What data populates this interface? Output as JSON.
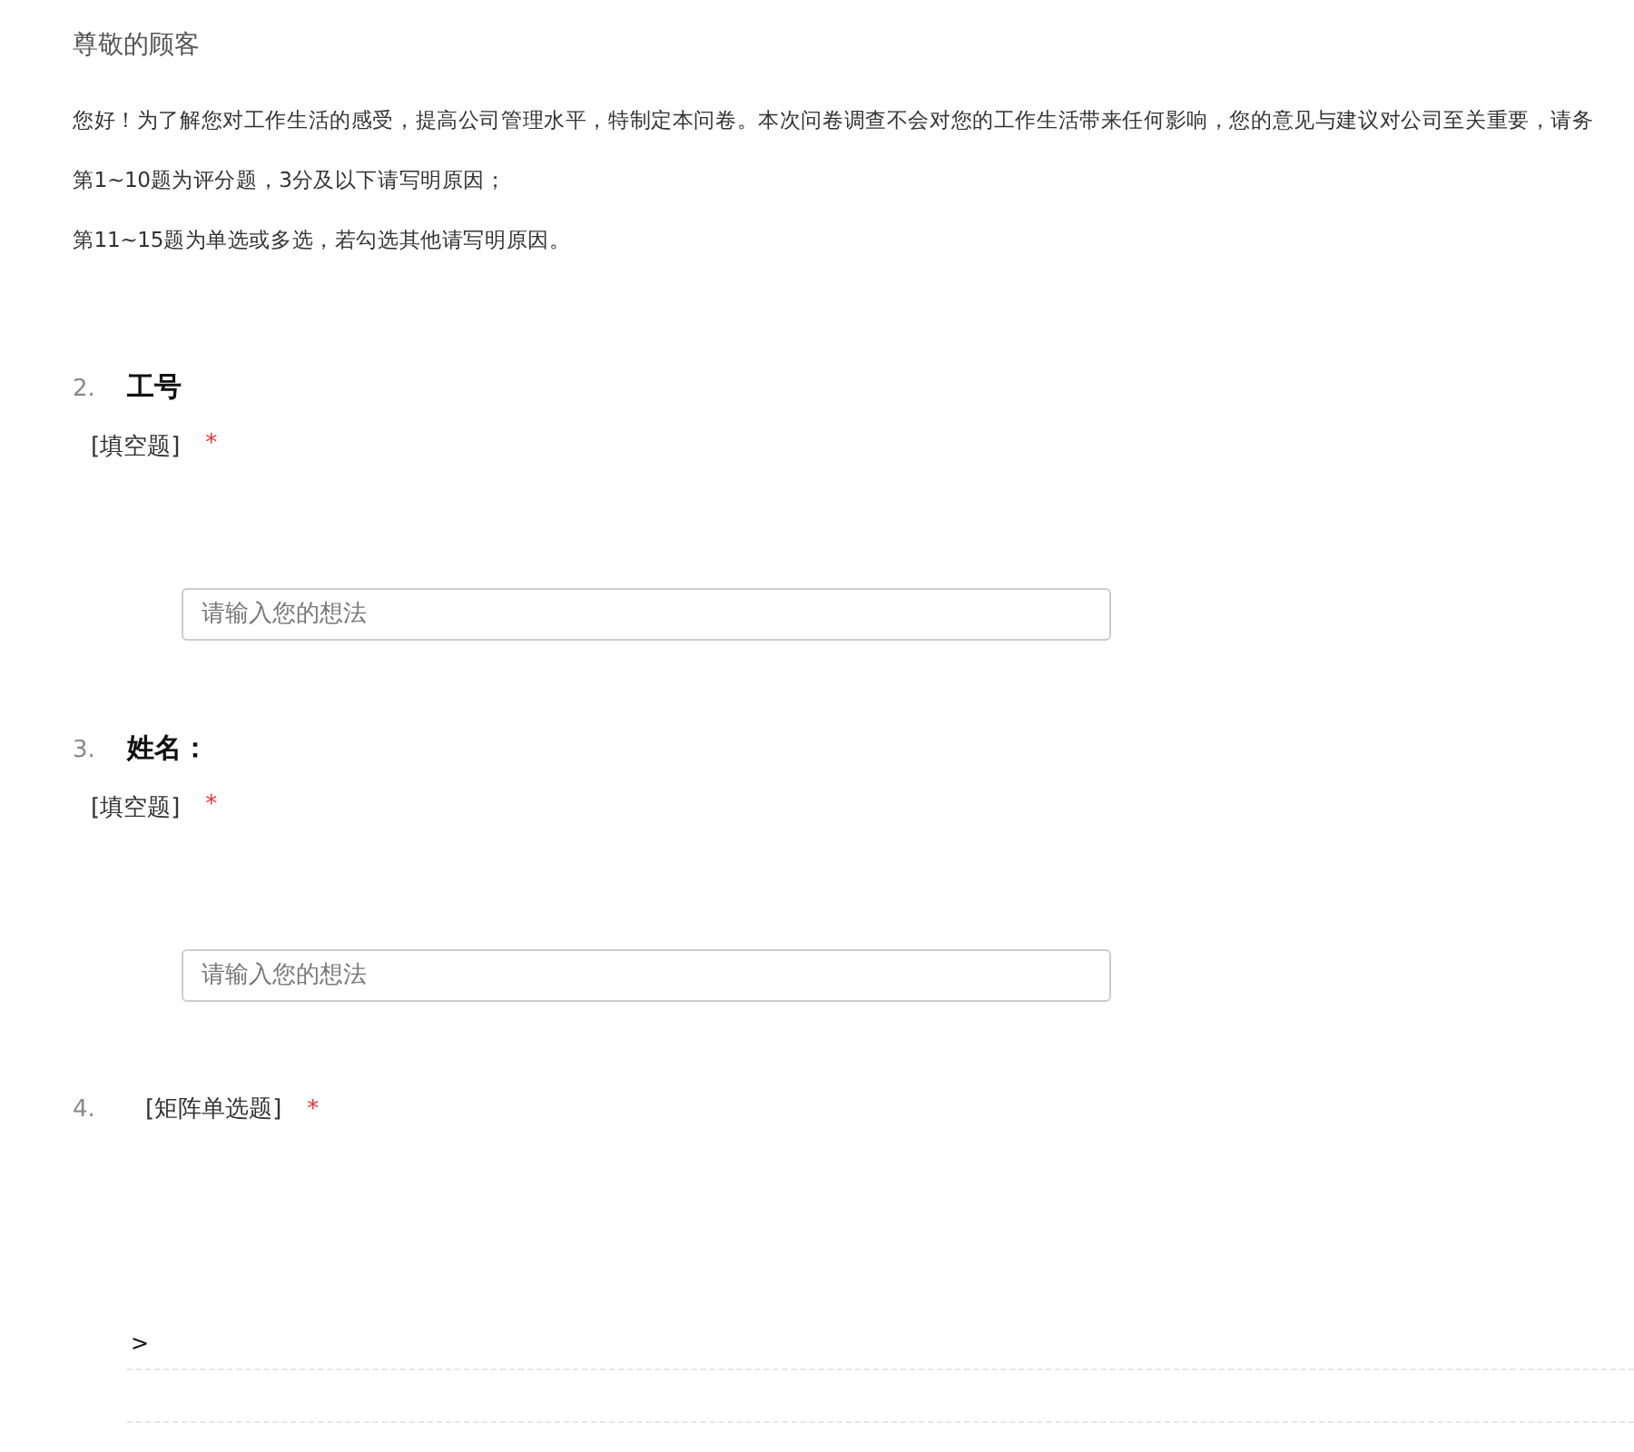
{
  "greeting": "尊敬的顾客",
  "intro": [
    "您好！为了解您对工作生活的感受，提高公司管理水平，特制定本问卷。本次问卷调查不会对您的工作生活带来任何影响，您的意见与建议对公司至关重要，请务",
    "第1~10题为评分题，3分及以下请写明原因；",
    "第11~15题为单选或多选，若勾选其他请写明原因。"
  ],
  "questions": [
    {
      "kind": "text",
      "number": "2.",
      "title": "工号",
      "type_label": "[填空题]",
      "required_mark": "*",
      "placeholder": "请输入您的想法"
    },
    {
      "kind": "text",
      "number": "3.",
      "title": "姓名：",
      "type_label": "[填空题]",
      "required_mark": "*",
      "placeholder": "请输入您的想法"
    },
    {
      "kind": "matrix",
      "number": "4.",
      "type_label": "[矩阵单选题]",
      "required_mark": "*",
      "rows": [
        ">"
      ]
    }
  ]
}
